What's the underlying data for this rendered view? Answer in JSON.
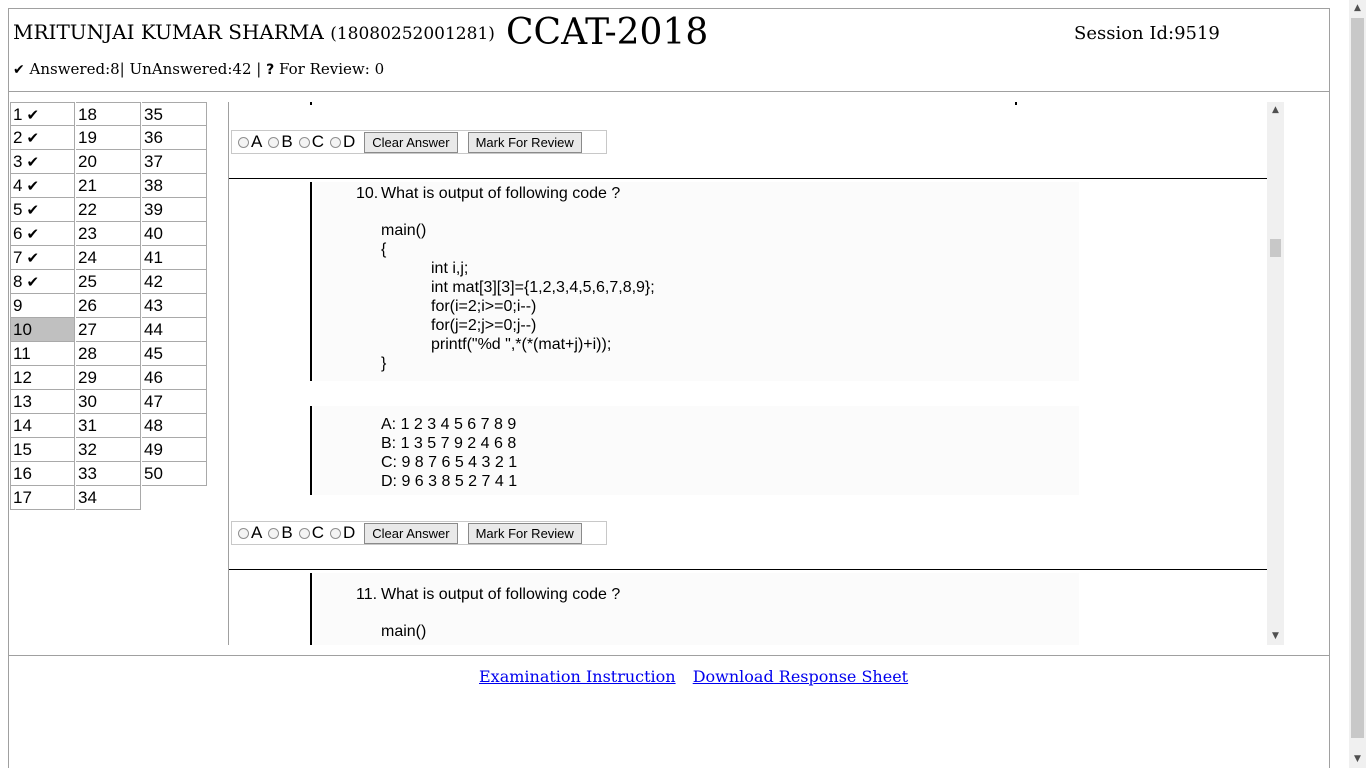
{
  "header": {
    "candidate_name": "MRITUNJAI KUMAR SHARMA",
    "candidate_roll": "(18080252001281)",
    "exam_title": "CCAT-2018",
    "session": "Session Id:9519",
    "answered": "Answered:8|",
    "unanswered": "UnAnswered:42",
    "divider": "|",
    "review": "For Review: 0"
  },
  "icons": {
    "check": "check-icon",
    "question": "question-icon"
  },
  "question_nav": [
    {
      "n": "1",
      "answered": true
    },
    {
      "n": "2",
      "answered": true
    },
    {
      "n": "3",
      "answered": true
    },
    {
      "n": "4",
      "answered": true
    },
    {
      "n": "5",
      "answered": true
    },
    {
      "n": "6",
      "answered": true
    },
    {
      "n": "7",
      "answered": true
    },
    {
      "n": "8",
      "answered": true
    },
    {
      "n": "9",
      "answered": false
    },
    {
      "n": "10",
      "answered": false,
      "current": true
    },
    {
      "n": "11",
      "answered": false
    },
    {
      "n": "12",
      "answered": false
    },
    {
      "n": "13",
      "answered": false
    },
    {
      "n": "14",
      "answered": false
    },
    {
      "n": "15",
      "answered": false
    },
    {
      "n": "16",
      "answered": false
    },
    {
      "n": "17",
      "answered": false
    },
    {
      "n": "18",
      "answered": false
    },
    {
      "n": "19",
      "answered": false
    },
    {
      "n": "20",
      "answered": false
    },
    {
      "n": "21",
      "answered": false
    },
    {
      "n": "22",
      "answered": false
    },
    {
      "n": "23",
      "answered": false
    },
    {
      "n": "24",
      "answered": false
    },
    {
      "n": "25",
      "answered": false
    },
    {
      "n": "26",
      "answered": false
    },
    {
      "n": "27",
      "answered": false
    },
    {
      "n": "28",
      "answered": false
    },
    {
      "n": "29",
      "answered": false
    },
    {
      "n": "30",
      "answered": false
    },
    {
      "n": "31",
      "answered": false
    },
    {
      "n": "32",
      "answered": false
    },
    {
      "n": "33",
      "answered": false
    },
    {
      "n": "34",
      "answered": false
    },
    {
      "n": "35",
      "answered": false
    },
    {
      "n": "36",
      "answered": false
    },
    {
      "n": "37",
      "answered": false
    },
    {
      "n": "38",
      "answered": false
    },
    {
      "n": "39",
      "answered": false
    },
    {
      "n": "40",
      "answered": false
    },
    {
      "n": "41",
      "answered": false
    },
    {
      "n": "42",
      "answered": false
    },
    {
      "n": "43",
      "answered": false
    },
    {
      "n": "44",
      "answered": false
    },
    {
      "n": "45",
      "answered": false
    },
    {
      "n": "46",
      "answered": false
    },
    {
      "n": "47",
      "answered": false
    },
    {
      "n": "48",
      "answered": false
    },
    {
      "n": "49",
      "answered": false
    },
    {
      "n": "50",
      "answered": false
    }
  ],
  "answer_controls": {
    "options": [
      "A",
      "B",
      "C",
      "D"
    ],
    "clear_label": "Clear Answer",
    "review_label": "Mark For Review"
  },
  "q10": {
    "number": "10.",
    "prompt": "What is output of following code ?",
    "code": [
      "main()",
      "{",
      "int i,j;",
      "int mat[3][3]={1,2,3,4,5,6,7,8,9};",
      "for(i=2;i>=0;i--)",
      "for(j=2;j>=0;j--)",
      "printf(\"%d \",*(*(mat+j)+i));",
      "}"
    ],
    "choices": [
      "A: 1 2 3 4 5 6 7 8 9",
      "B: 1 3 5 7 9 2 4 6 8",
      "C: 9 8 7 6 5 4 3 2 1",
      "D: 9 6 3 8 5 2 7 4 1"
    ]
  },
  "q11": {
    "number": "11.",
    "prompt": "What is output of following code ?",
    "code_first": "main()"
  },
  "footer": {
    "instruction_link": "Examination Instruction",
    "download_link": "Download Response Sheet"
  }
}
